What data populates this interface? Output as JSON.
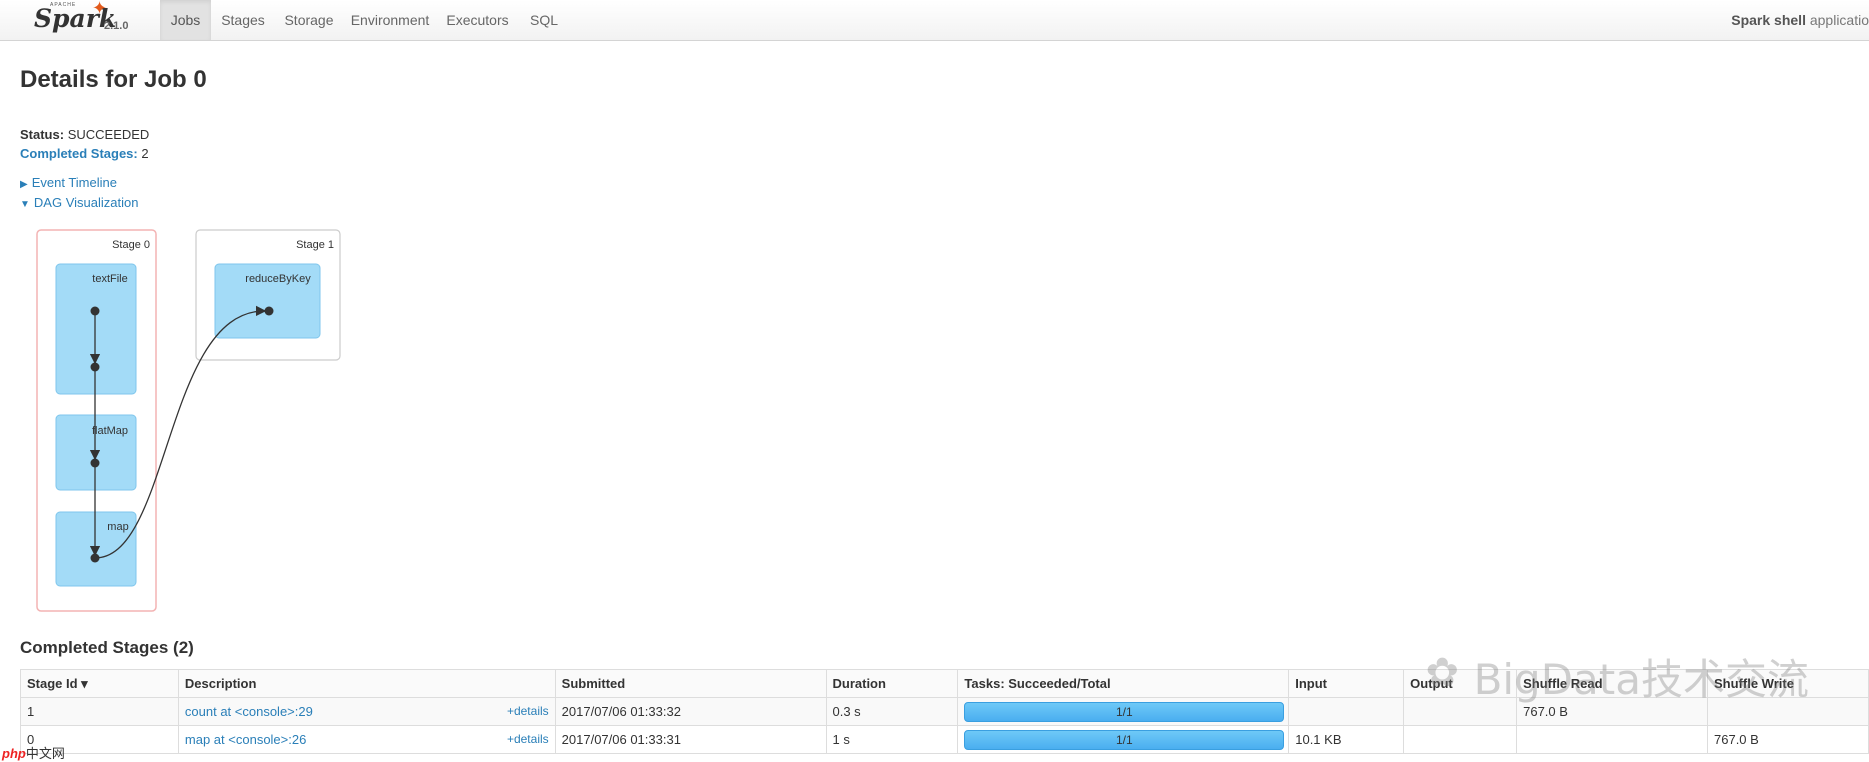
{
  "navbar": {
    "brand": {
      "apache_label": "APACHE",
      "name": "Spark",
      "version": "2.1.0"
    },
    "tabs": [
      {
        "label": "Jobs",
        "active": true
      },
      {
        "label": "Stages",
        "active": false
      },
      {
        "label": "Storage",
        "active": false
      },
      {
        "label": "Environment",
        "active": false
      },
      {
        "label": "Executors",
        "active": false
      },
      {
        "label": "SQL",
        "active": false
      }
    ],
    "app_name": "Spark shell",
    "app_suffix": "applicatio"
  },
  "page_title": "Details for Job 0",
  "summary": {
    "status_label": "Status:",
    "status_value": "SUCCEEDED",
    "completed_label": "Completed Stages:",
    "completed_value": "2"
  },
  "toggles": {
    "event_timeline": "Event Timeline",
    "dag_visualization": "DAG Visualization"
  },
  "dag": {
    "stages": [
      {
        "label": "Stage 0",
        "rdds": [
          "textFile",
          "flatMap",
          "map"
        ]
      },
      {
        "label": "Stage 1",
        "rdds": [
          "reduceByKey"
        ]
      }
    ]
  },
  "completed_stages": {
    "title": "Completed Stages (2)",
    "columns": [
      "Stage Id ▾",
      "Description",
      "Submitted",
      "Duration",
      "Tasks: Succeeded/Total",
      "Input",
      "Output",
      "Shuffle Read",
      "Shuffle Write"
    ],
    "details_label": "+details",
    "rows": [
      {
        "id": "1",
        "description": "count at <console>:29",
        "submitted": "2017/07/06 01:33:32",
        "duration": "0.3 s",
        "tasks": "1/1",
        "tasks_fraction": 1.0,
        "input": "",
        "output": "",
        "shuffle_read": "767.0 B",
        "shuffle_write": ""
      },
      {
        "id": "0",
        "description": "map at <console>:26",
        "submitted": "2017/07/06 01:33:31",
        "duration": "1 s",
        "tasks": "1/1",
        "tasks_fraction": 1.0,
        "input": "10.1 KB",
        "output": "",
        "shuffle_read": "",
        "shuffle_write": "767.0 B"
      }
    ]
  },
  "watermark": {
    "text": "BigData技术交流",
    "php_label": "php",
    "php_suffix": "中文网"
  },
  "colors": {
    "link": "#2a7fb8",
    "rdd_fill": "#a3dbf7",
    "rdd_stroke": "#7fc6ec",
    "stage0_border": "#f3b3b3",
    "progress": "#4aaef0",
    "spark_orange": "#e25a1c"
  }
}
